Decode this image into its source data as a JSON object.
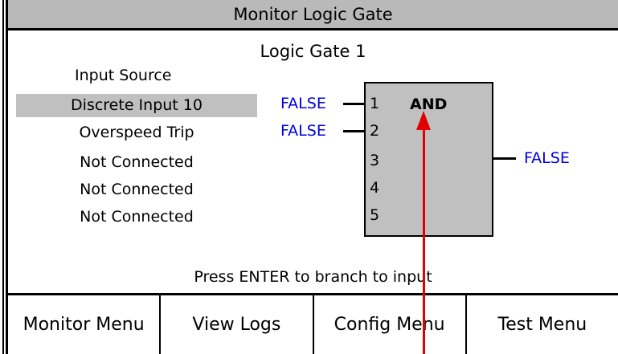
{
  "title": "Monitor Logic Gate",
  "gate": {
    "title": "Logic Gate 1",
    "type": "AND",
    "output_value": "FALSE"
  },
  "input_source": {
    "header": "Input Source",
    "items": [
      {
        "label": "Discrete Input 10",
        "selected": true
      },
      {
        "label": "Overspeed Trip",
        "selected": false
      },
      {
        "label": "Not Connected",
        "selected": false
      },
      {
        "label": "Not Connected",
        "selected": false
      },
      {
        "label": "Not Connected",
        "selected": false
      }
    ]
  },
  "inputs": [
    {
      "pin": "1",
      "value": "FALSE"
    },
    {
      "pin": "2",
      "value": "FALSE"
    },
    {
      "pin": "3",
      "value": ""
    },
    {
      "pin": "4",
      "value": ""
    },
    {
      "pin": "5",
      "value": ""
    }
  ],
  "hint": "Press ENTER to branch to input",
  "menu": [
    "Monitor Menu",
    "View Logs",
    "Config Menu",
    "Test Menu"
  ],
  "colors": {
    "title_bar": "#b9b9b9",
    "selection": "#c0c0c0",
    "value_text": "#0000e0",
    "annotation_arrow": "#e00000"
  }
}
